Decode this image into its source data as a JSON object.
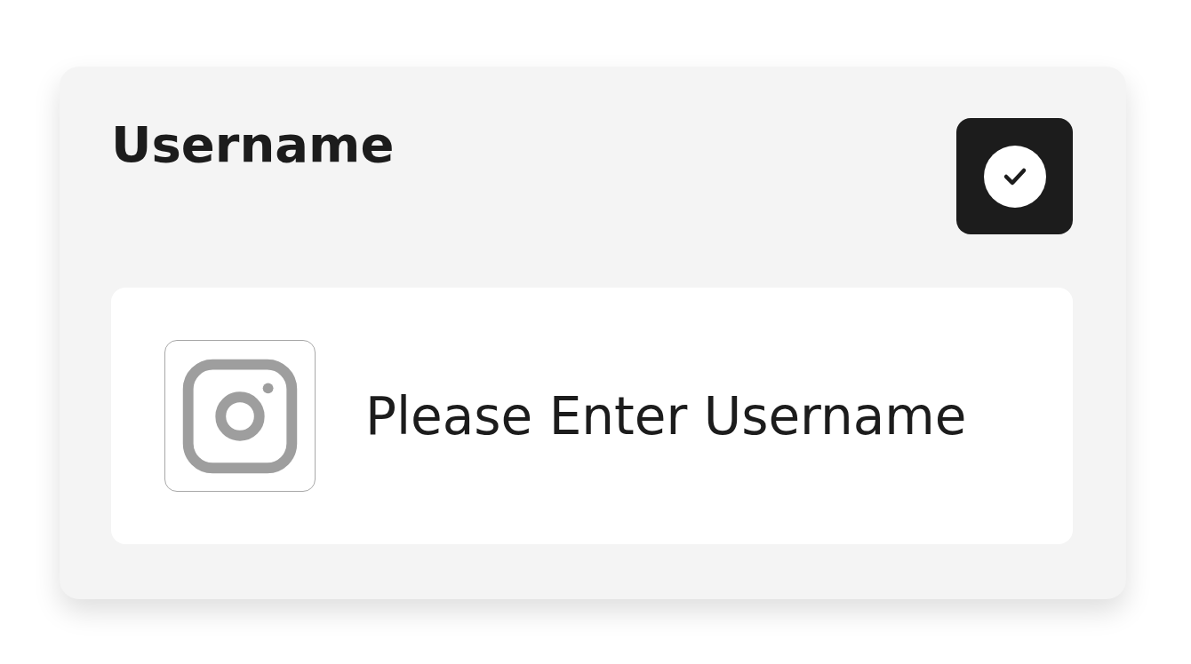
{
  "card": {
    "label": "Username",
    "placeholder": "Please Enter Username"
  }
}
